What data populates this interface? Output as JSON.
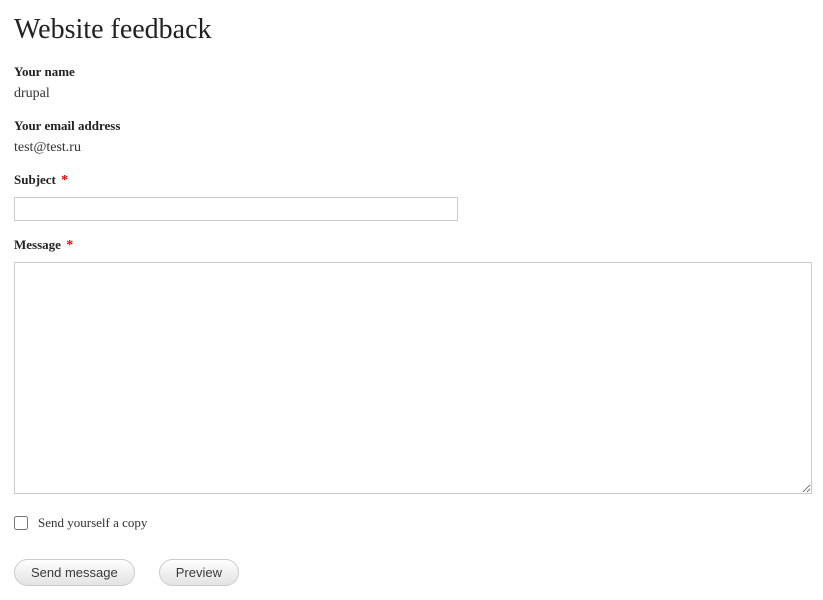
{
  "page": {
    "title": "Website feedback"
  },
  "form": {
    "name_label": "Your name",
    "name_value": "drupal",
    "email_label": "Your email address",
    "email_value": "test@test.ru",
    "subject_label": "Subject",
    "subject_value": "",
    "message_label": "Message",
    "message_value": "",
    "required_marker": "*",
    "copy_label": "Send yourself a copy",
    "submit_label": "Send message",
    "preview_label": "Preview"
  }
}
